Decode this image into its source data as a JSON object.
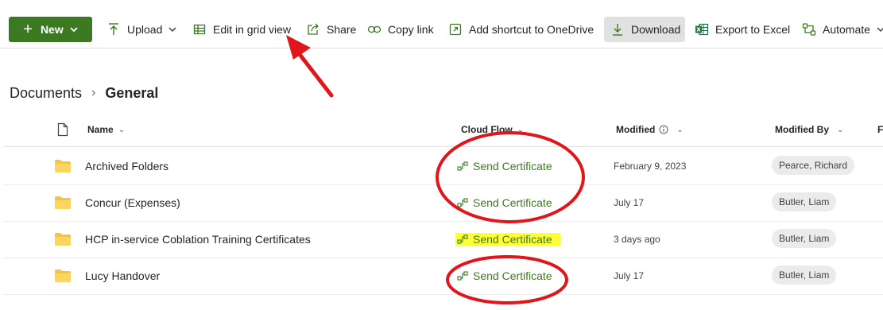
{
  "toolbar": {
    "new_label": "New",
    "upload_label": "Upload",
    "edit_grid_label": "Edit in grid view",
    "share_label": "Share",
    "copy_link_label": "Copy link",
    "shortcut_label": "Add shortcut to OneDrive",
    "download_label": "Download",
    "export_label": "Export to Excel",
    "automate_label": "Automate"
  },
  "breadcrumb": {
    "root": "Documents",
    "current": "General"
  },
  "columns": {
    "name": "Name",
    "flow": "Cloud Flow",
    "modified": "Modified",
    "modified_by": "Modified By",
    "extra": "F"
  },
  "rows": [
    {
      "name": "Archived Folders",
      "flow": "Send Certificate",
      "modified": "February 9, 2023",
      "modified_by": "Pearce, Richard"
    },
    {
      "name": "Concur (Expenses)",
      "flow": "Send Certificate",
      "modified": "July 17",
      "modified_by": "Butler, Liam"
    },
    {
      "name": "HCP in-service Coblation Training Certificates",
      "flow": "Send Certificate",
      "modified": "3 days ago",
      "modified_by": "Butler, Liam"
    },
    {
      "name": "Lucy Handover",
      "flow": "Send Certificate",
      "modified": "July 17",
      "modified_by": "Butler, Liam"
    }
  ],
  "colors": {
    "accent": "#3b7a22",
    "annotation_red": "#e0161b",
    "highlight": "#ffff33",
    "folder": "#f6c343"
  }
}
